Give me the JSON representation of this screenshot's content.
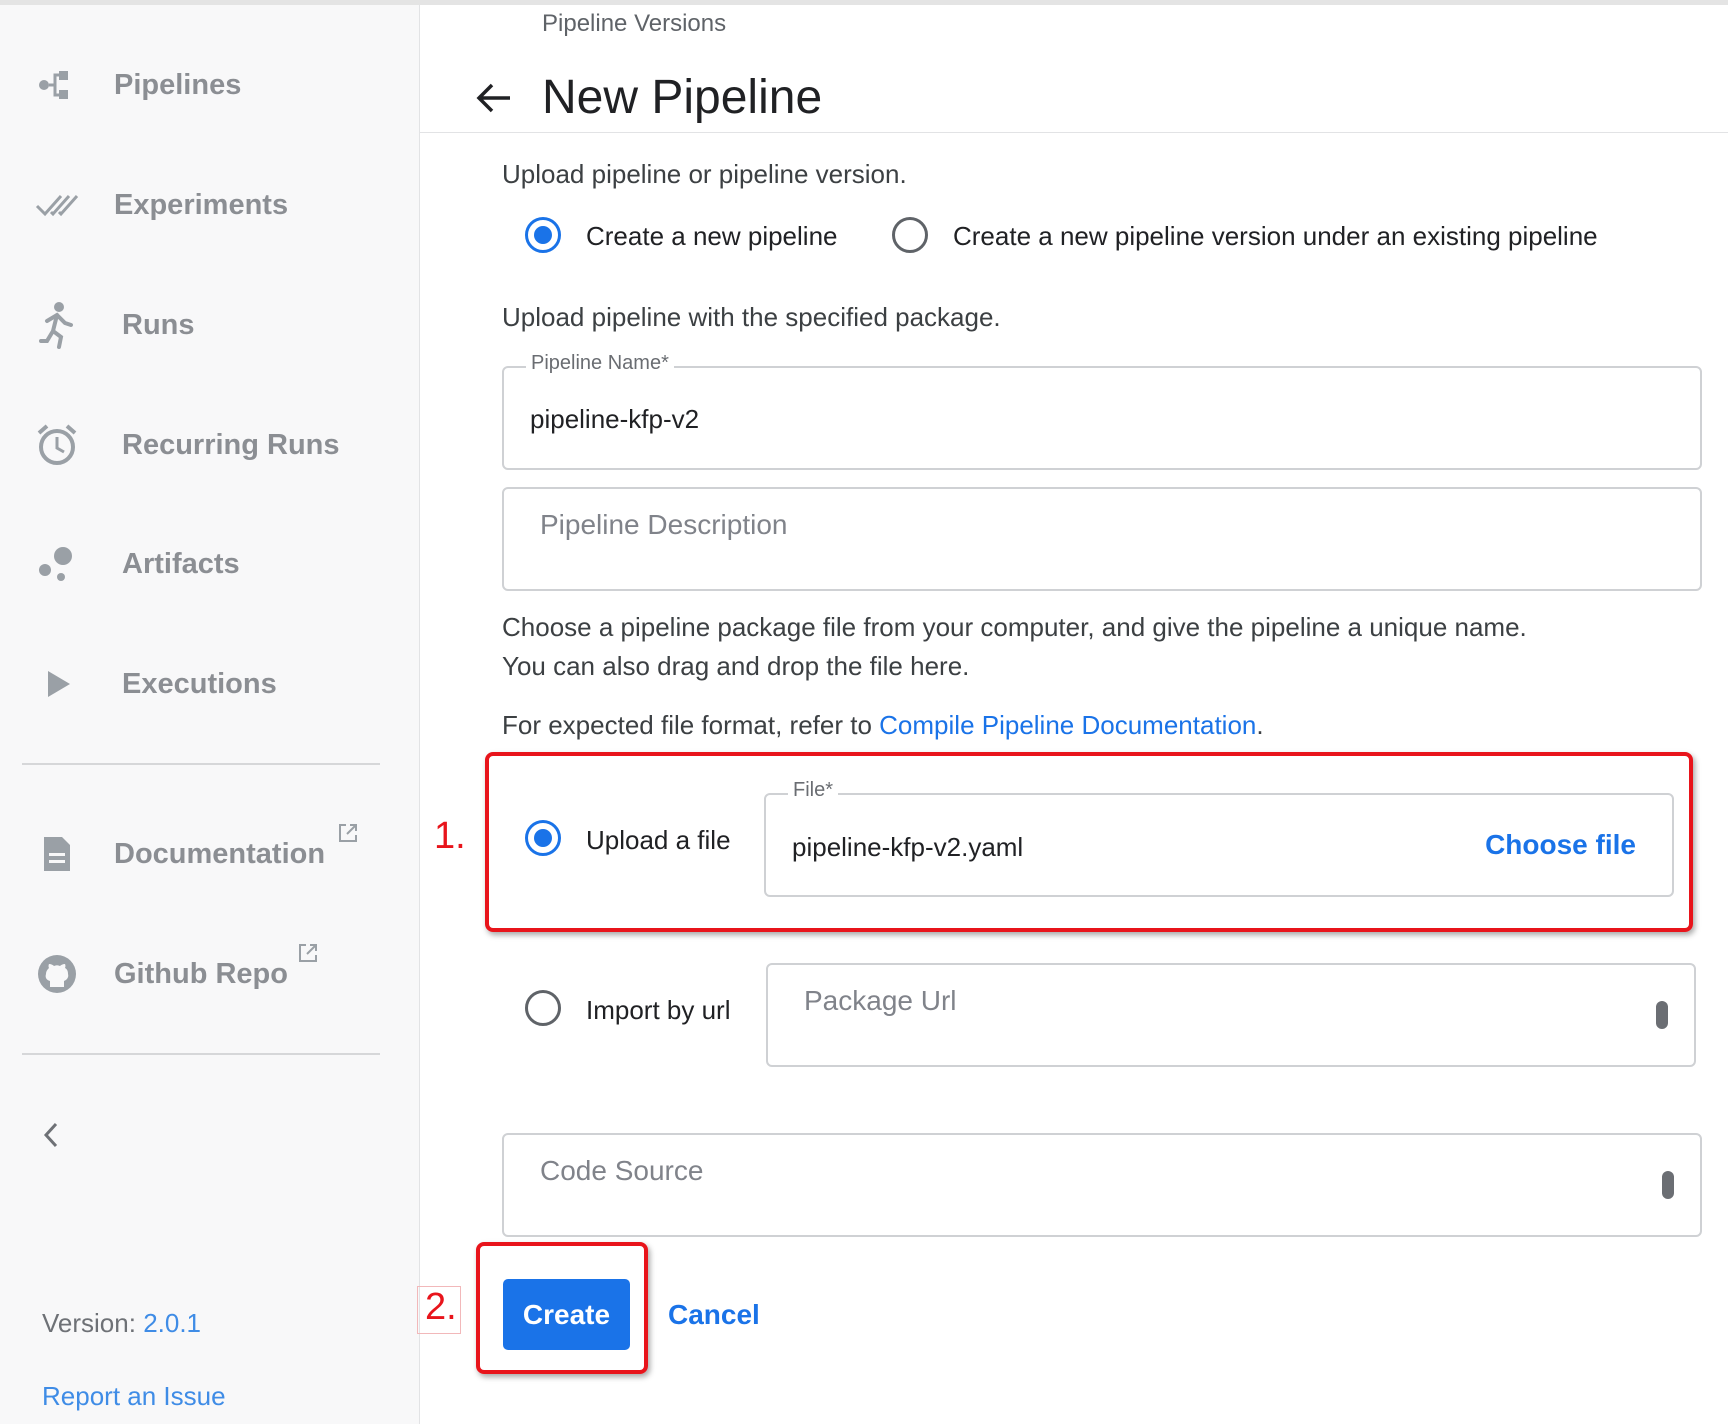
{
  "sidebar": {
    "items": [
      {
        "label": "Pipelines",
        "icon": "pipeline-icon"
      },
      {
        "label": "Experiments",
        "icon": "experiments-check-icon"
      },
      {
        "label": "Runs",
        "icon": "run-icon"
      },
      {
        "label": "Recurring Runs",
        "icon": "alarm-clock-icon"
      },
      {
        "label": "Artifacts",
        "icon": "bubbles-icon"
      },
      {
        "label": "Executions",
        "icon": "play-icon"
      }
    ],
    "links": [
      {
        "label": "Documentation",
        "icon": "document-icon"
      },
      {
        "label": "Github Repo",
        "icon": "github-icon"
      }
    ],
    "version_label": "Version:",
    "version_value": "2.0.1",
    "report_issue": "Report an Issue"
  },
  "header": {
    "breadcrumb": "Pipeline Versions",
    "title": "New Pipeline"
  },
  "form": {
    "intro": "Upload pipeline or pipeline version.",
    "mode_options": [
      {
        "label": "Create a new pipeline",
        "selected": true
      },
      {
        "label": "Create a new pipeline version under an existing pipeline",
        "selected": false
      }
    ],
    "package_note": "Upload pipeline with the specified package.",
    "pipeline_name_label": "Pipeline Name*",
    "pipeline_name_value": "pipeline-kfp-v2",
    "description_placeholder": "Pipeline Description",
    "choose_text_line1": "Choose a pipeline package file from your computer, and give the pipeline a unique name.",
    "choose_text_line2": "You can also drag and drop the file here.",
    "format_prefix": "For expected file format, refer to ",
    "format_link": "Compile Pipeline Documentation",
    "format_suffix": ".",
    "upload_label": "Upload a file",
    "file_label": "File*",
    "file_value": "pipeline-kfp-v2.yaml",
    "choose_file": "Choose file",
    "import_label": "Import by url",
    "package_url_placeholder": "Package Url",
    "code_source_placeholder": "Code Source",
    "create_button": "Create",
    "cancel_button": "Cancel"
  },
  "annotations": {
    "step1": "1.",
    "step2": "2.",
    "color": "#e8141b"
  },
  "colors": {
    "accent": "#1a73e8",
    "sidebar_bg": "#f8f8f9"
  }
}
